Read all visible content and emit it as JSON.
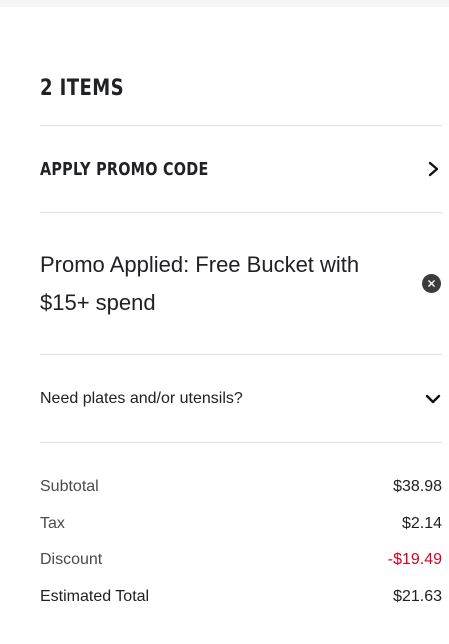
{
  "cart": {
    "items_title": "2 ITEMS"
  },
  "promo": {
    "label": "APPLY PROMO CODE",
    "applied_text": "Promo Applied: Free Bucket with $15+ spend"
  },
  "plates": {
    "label": "Need plates and/or utensils?"
  },
  "totals": {
    "subtotal_label": "Subtotal",
    "subtotal_value": "$38.98",
    "tax_label": "Tax",
    "tax_value": "$2.14",
    "discount_label": "Discount",
    "discount_value": "-$19.49",
    "estimated_label": "Estimated Total",
    "estimated_value": "$21.63"
  },
  "icons": {
    "promo_chevron": "chevron-right-icon",
    "remove_promo": "close-icon",
    "plates_chevron": "chevron-down-icon"
  },
  "colors": {
    "discount": "#d70022",
    "text": "#202124",
    "divider": "#e3e3e3"
  }
}
